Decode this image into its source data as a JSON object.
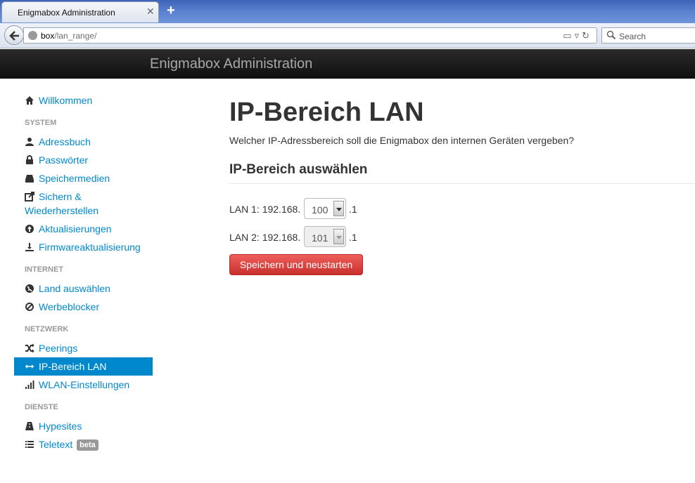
{
  "browser": {
    "tab_title": "Enigmabox Administration",
    "tab_close": "✕",
    "new_tab": "+",
    "url_host": "box",
    "url_path": "/lan_range/",
    "search_placeholder": "Search"
  },
  "header": {
    "brand": "Enigmabox Administration"
  },
  "sidebar": {
    "welcome": "Willkommen",
    "system_header": "SYSTEM",
    "system_items": [
      "Adressbuch",
      "Passwörter",
      "Speichermedien",
      "Sichern & Wiederherstellen",
      "Aktualisierungen",
      "Firmwareaktualisierung"
    ],
    "internet_header": "INTERNET",
    "internet_items": [
      "Land auswählen",
      "Werbeblocker"
    ],
    "network_header": "NETZWERK",
    "network_items": [
      "Peerings",
      "IP-Bereich LAN",
      "WLAN-Einstellungen"
    ],
    "services_header": "DIENSTE",
    "services_items": [
      "Hypesites",
      "Teletext"
    ],
    "beta_badge": "beta"
  },
  "main": {
    "title": "IP-Bereich LAN",
    "lead": "Welcher IP-Adressbereich soll die Enigmabox den internen Geräten vergeben?",
    "subheading": "IP-Bereich auswählen",
    "lan1_label": "LAN 1: 192.168.",
    "lan1_value": "100",
    "lan1_suffix": ".1",
    "lan2_label": "LAN 2: 192.168.",
    "lan2_value": "101",
    "lan2_suffix": ".1",
    "submit_label": "Speichern und neustarten"
  },
  "colors": {
    "link": "#0088cc",
    "active_bg": "#0088cc",
    "danger": "#da4f49"
  }
}
